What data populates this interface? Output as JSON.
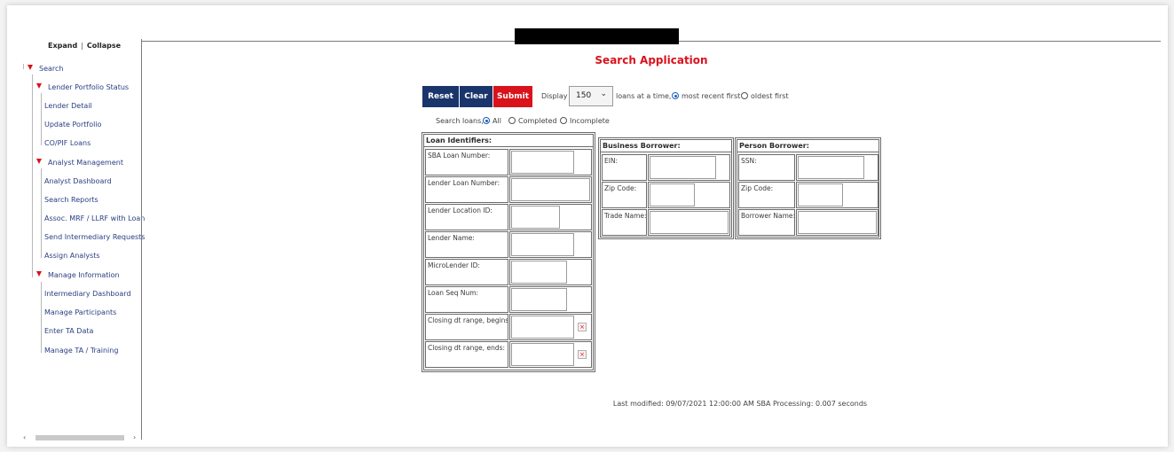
{
  "sidebar": {
    "expand_label": "Expand",
    "sep": "|",
    "collapse_label": "Collapse",
    "tree": {
      "search": "Search",
      "lender_portfolio_status": "Lender Portfolio Status",
      "lender_detail": "Lender Detail",
      "update_portfolio": "Update Portfolio",
      "co_pif_loans": "CO/PIF Loans",
      "analyst_management": "Analyst Management",
      "analyst_dashboard": "Analyst Dashboard",
      "search_reports": "Search Reports",
      "assoc_mrf": "Assoc. MRF / LLRF with Loan",
      "send_intermediary": "Send Intermediary Requests",
      "assign_analysts": "Assign Analysts",
      "manage_information": "Manage Information",
      "intermediary_dashboard": "Intermediary Dashboard",
      "manage_participants": "Manage Participants",
      "enter_ta_data": "Enter TA Data",
      "manage_ta_training": "Manage TA / Training"
    }
  },
  "main": {
    "title": "Search Application",
    "buttons": {
      "reset": "Reset",
      "clear": "Clear",
      "submit": "Submit"
    },
    "display_label": "Display",
    "display_value": "150",
    "loans_at_time": "loans at a time,",
    "most_recent": "most recent first",
    "oldest": "oldest first",
    "search_loans_label": "Search loans,",
    "filter_all": "All",
    "filter_completed": "Completed",
    "filter_incomplete": "Incomplete"
  },
  "loan_identifiers": {
    "header": "Loan Identifiers:",
    "sba_loan_number": "SBA Loan Number:",
    "lender_loan_number": "Lender Loan Number:",
    "lender_location_id": "Lender Location ID:",
    "lender_name": "Lender Name:",
    "microlender_id": "MicroLender ID:",
    "loan_seq_num": "Loan Seq Num:",
    "closing_begins": "Closing dt range, begins:",
    "closing_ends": "Closing dt range, ends:"
  },
  "business_borrower": {
    "header": "Business Borrower:",
    "ein": "EIN:",
    "zip_code": "Zip Code:",
    "trade_name": "Trade Name:"
  },
  "person_borrower": {
    "header": "Person Borrower:",
    "ssn": "SSN:",
    "zip_code": "Zip Code:",
    "borrower_name": "Borrower Name:"
  },
  "footer": {
    "text": "Last modified: 09/07/2021 12:00:00 AM  SBA Processing:  0.007 seconds"
  },
  "colors": {
    "brand_red": "#d9121c",
    "navy": "#1a356c",
    "link_blue": "#2a3e82"
  },
  "icons": {
    "tree_toggle": "triangle-down-icon",
    "calendar": "calendar-icon",
    "dropdown": "chevron-down-icon"
  }
}
